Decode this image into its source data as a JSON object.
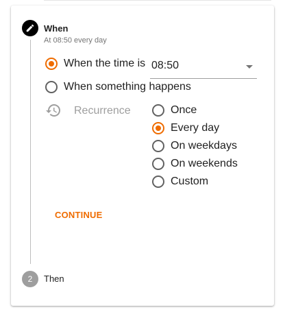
{
  "step1": {
    "title": "When",
    "subtitle": "At 08:50 every day",
    "icon": "pencil-icon"
  },
  "trigger": {
    "option_time": "When the time is",
    "option_event": "When something happens",
    "selected": "time",
    "time_value": "08:50"
  },
  "recurrence": {
    "label": "Recurrence",
    "icon": "history-icon",
    "options": [
      "Once",
      "Every day",
      "On weekdays",
      "On weekends",
      "Custom"
    ],
    "selected": "Every day"
  },
  "continue_label": "CONTINUE",
  "step2": {
    "number": "2",
    "title": "Then"
  },
  "colors": {
    "accent": "#ef6c00",
    "active_step": "#000000",
    "inactive_step": "#9e9e9e"
  }
}
